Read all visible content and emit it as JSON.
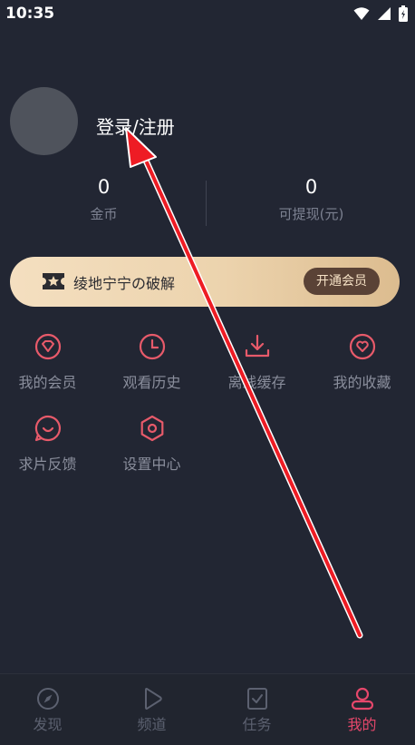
{
  "status": {
    "time": "10:35"
  },
  "profile": {
    "login_label": "登录/注册"
  },
  "stats": [
    {
      "value": "0",
      "label": "金币"
    },
    {
      "value": "0",
      "label": "可提现(元)"
    }
  ],
  "vip": {
    "title": "绫地宁宁の破解",
    "button": "开通会员"
  },
  "menu": [
    {
      "label": "我的会员"
    },
    {
      "label": "观看历史"
    },
    {
      "label": "离线缓存"
    },
    {
      "label": "我的收藏"
    },
    {
      "label": "求片反馈"
    },
    {
      "label": "设置中心"
    }
  ],
  "nav": [
    {
      "label": "发现"
    },
    {
      "label": "频道"
    },
    {
      "label": "任务"
    },
    {
      "label": "我的"
    }
  ],
  "colors": {
    "accent": "#e6476b",
    "icon": "#e75a6a",
    "background": "#222633",
    "muted": "#8a8e9c",
    "vip_gold": "#ecd3ad"
  }
}
